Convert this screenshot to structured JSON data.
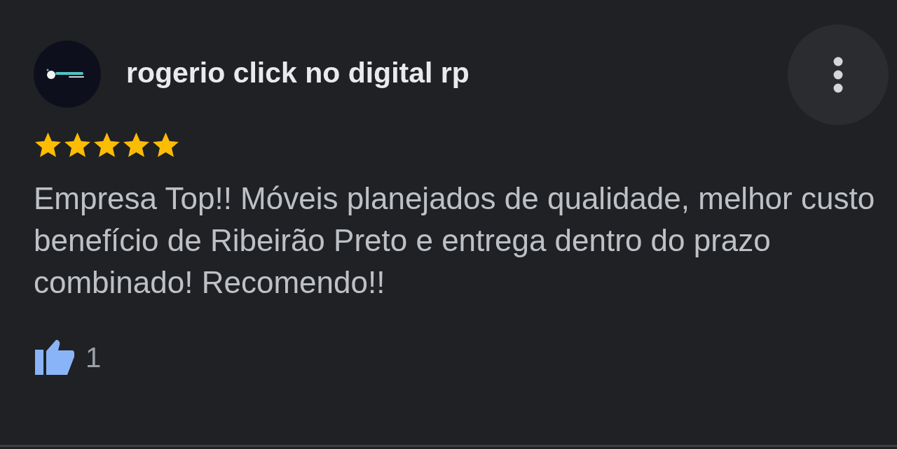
{
  "review": {
    "reviewer_name": "rogerio click no digital rp",
    "stars": 5,
    "text": "Empresa Top!! Móveis planejados de qualidade, melhor custo benefício de Ribeirão Preto e entrega dentro do prazo combinado! Recomendo!!",
    "helpful": {
      "liked": true,
      "count": "1"
    }
  }
}
